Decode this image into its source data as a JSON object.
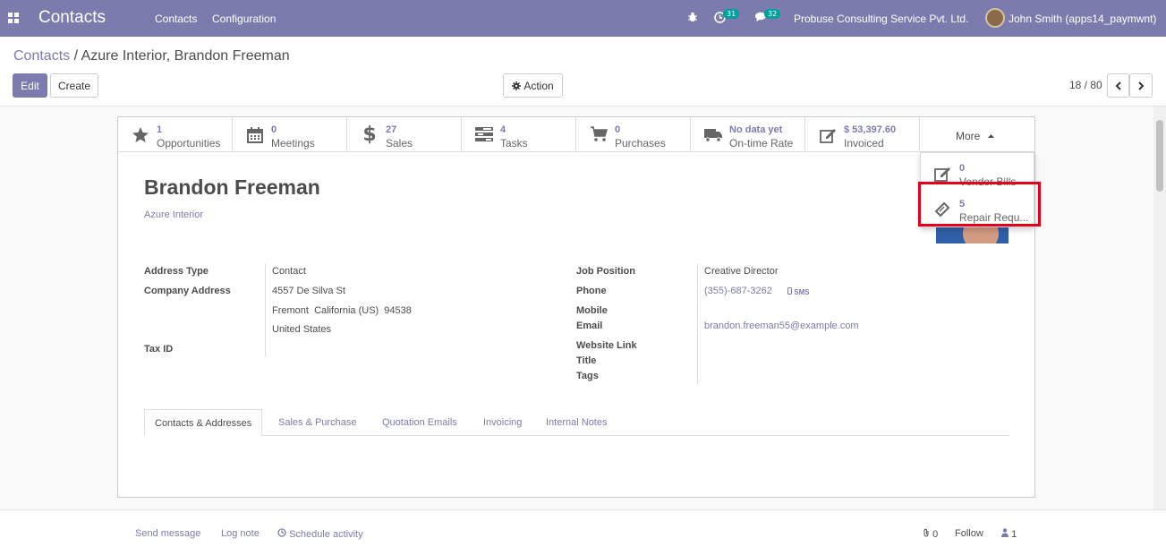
{
  "navbar": {
    "app_title": "Contacts",
    "menu": [
      "Contacts",
      "Configuration"
    ],
    "activities_count": "31",
    "messages_count": "32",
    "company": "Probuse Consulting Service Pvt. Ltd.",
    "user": "John Smith (apps14_paymwnt)"
  },
  "breadcrumb": {
    "parent": "Contacts",
    "separator": "/",
    "current": "Azure Interior, Brandon Freeman"
  },
  "buttons": {
    "edit": "Edit",
    "create": "Create",
    "action": "Action"
  },
  "pager": {
    "value": "18 / 80"
  },
  "stat_buttons": [
    {
      "value": "1",
      "label": "Opportunities",
      "icon": "star-icon"
    },
    {
      "value": "0",
      "label": "Meetings",
      "icon": "calendar-icon"
    },
    {
      "value": "27",
      "label": "Sales",
      "icon": "dollar-icon"
    },
    {
      "value": "4",
      "label": "Tasks",
      "icon": "tasks-icon"
    },
    {
      "value": "0",
      "label": "Purchases",
      "icon": "cart-icon"
    },
    {
      "value": "No data yet",
      "label": "On-time Rate",
      "icon": "truck-icon"
    },
    {
      "value": "$ 53,397.60",
      "label": "Invoiced",
      "icon": "edit-icon"
    }
  ],
  "more": {
    "label": "More"
  },
  "more_menu": [
    {
      "value": "0",
      "label": "Vendor Bills",
      "icon": "edit-icon"
    },
    {
      "value": "5",
      "label": "Repair Requ...",
      "icon": "ticket-icon"
    }
  ],
  "partner": {
    "name": "Brandon Freeman",
    "company": "Azure Interior"
  },
  "fields": {
    "address_type_label": "Address Type",
    "address_type": "Contact",
    "company_address_label": "Company Address",
    "street": "4557 De Silva St",
    "city_line": "Fremont  California (US)  94538",
    "country": "United States",
    "tax_id_label": "Tax ID",
    "job_position_label": "Job Position",
    "job_position": "Creative Director",
    "phone_label": "Phone",
    "phone": "(355)-687-3262",
    "sms": "SMS",
    "mobile_label": "Mobile",
    "email_label": "Email",
    "email": "brandon.freeman55@example.com",
    "website_label": "Website Link",
    "title_label": "Title",
    "tags_label": "Tags"
  },
  "tabs": [
    "Contacts & Addresses",
    "Sales & Purchase",
    "Quotation Emails",
    "Invoicing",
    "Internal Notes"
  ],
  "chatter": {
    "send_message": "Send message",
    "log_note": "Log note",
    "schedule_activity": "Schedule activity",
    "attachments": "0",
    "follow": "Follow",
    "followers": "1"
  },
  "colors": {
    "primary": "#7c7bad",
    "highlight": "#e2001a",
    "badge": "#00a09d"
  }
}
